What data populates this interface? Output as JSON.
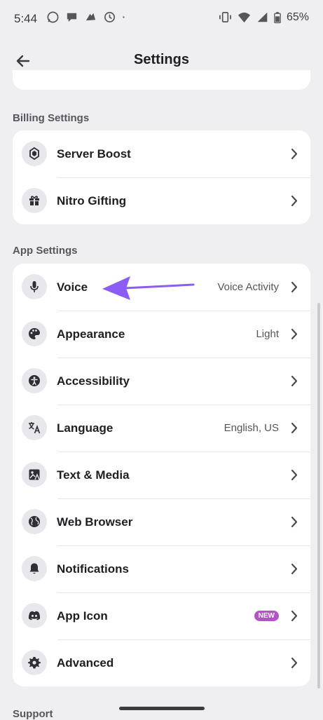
{
  "status_bar": {
    "time": "5:44",
    "battery": "65%"
  },
  "header": {
    "title": "Settings"
  },
  "billing": {
    "label": "Billing Settings",
    "items": [
      {
        "label": "Server Boost",
        "icon": "server-boost-icon"
      },
      {
        "label": "Nitro Gifting",
        "icon": "gift-icon"
      }
    ]
  },
  "app": {
    "label": "App Settings",
    "items": [
      {
        "label": "Voice",
        "value": "Voice Activity",
        "icon": "microphone-icon"
      },
      {
        "label": "Appearance",
        "value": "Light",
        "icon": "palette-icon"
      },
      {
        "label": "Accessibility",
        "value": "",
        "icon": "accessibility-icon"
      },
      {
        "label": "Language",
        "value": "English, US",
        "icon": "translate-icon"
      },
      {
        "label": "Text & Media",
        "value": "",
        "icon": "image-text-icon"
      },
      {
        "label": "Web Browser",
        "value": "",
        "icon": "globe-icon"
      },
      {
        "label": "Notifications",
        "value": "",
        "icon": "bell-icon"
      },
      {
        "label": "App Icon",
        "badge": "NEW",
        "icon": "discord-icon"
      },
      {
        "label": "Advanced",
        "value": "",
        "icon": "gear-icon"
      }
    ]
  },
  "support": {
    "label": "Support"
  },
  "colors": {
    "accent_arrow": "#8b5cf6",
    "badge": "#b552c9"
  }
}
